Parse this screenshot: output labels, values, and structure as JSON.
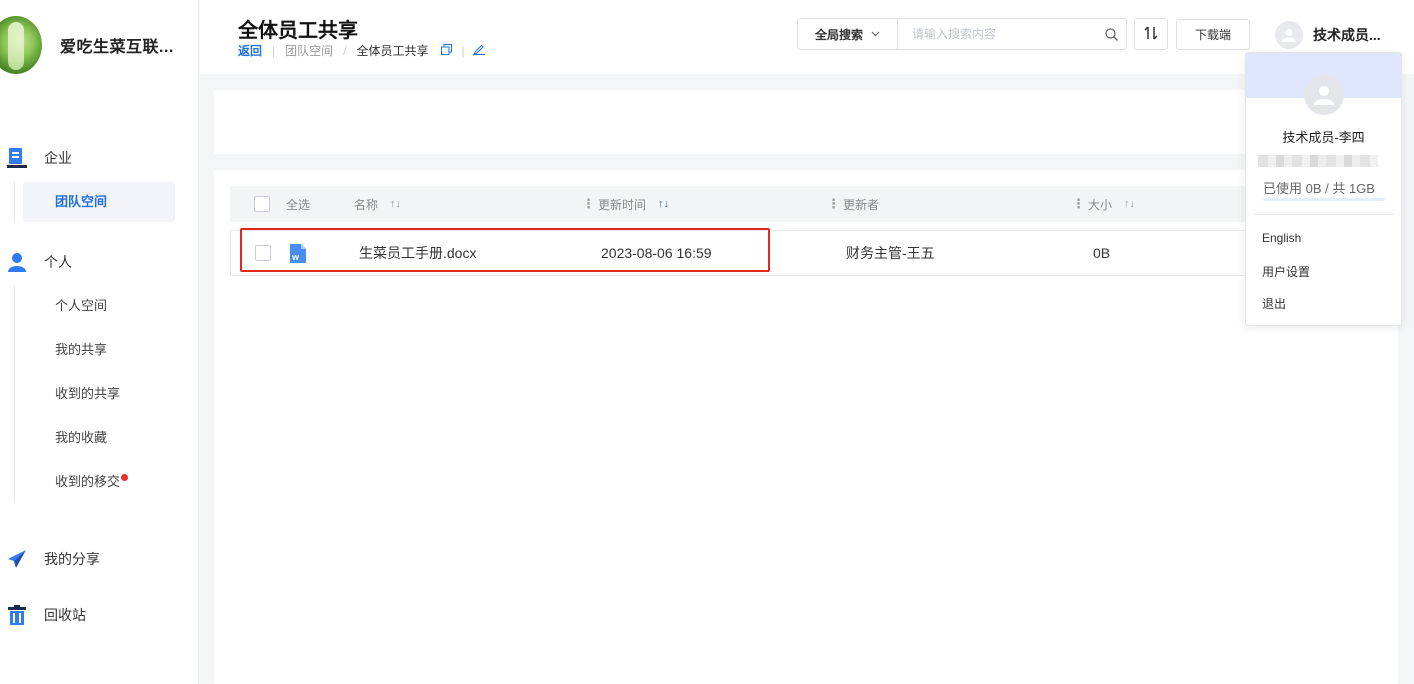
{
  "app": {
    "name": "爱吃生菜互联..."
  },
  "sidebar": {
    "enterprise": {
      "label": "企业",
      "items": [
        {
          "label": "团队空间",
          "active": true
        }
      ]
    },
    "personal": {
      "label": "个人",
      "items": [
        {
          "label": "个人空间"
        },
        {
          "label": "我的共享"
        },
        {
          "label": "收到的共享"
        },
        {
          "label": "我的收藏"
        },
        {
          "label": "收到的移交",
          "badge": "red-dot"
        }
      ]
    },
    "share": {
      "label": "我的分享"
    },
    "recycle": {
      "label": "回收站"
    }
  },
  "header": {
    "title": "全体员工共享",
    "breadcrumb": {
      "back": "返回",
      "parent": "团队空间",
      "current": "全体员工共享"
    },
    "search": {
      "scope": "全局搜索",
      "placeholder": "请输入搜索内容",
      "value": ""
    },
    "download_label": "下载端",
    "user_short": "技术成员..."
  },
  "table": {
    "select_all": "全选",
    "columns": {
      "name": "名称",
      "updated_at": "更新时间",
      "updater": "更新者",
      "size": "大小"
    },
    "rows": [
      {
        "name": "生菜员工手册.docx",
        "updated_at": "2023-08-06 16:59",
        "updater": "财务主管-王五",
        "size": "0B",
        "file_type": "word-doc-icon"
      }
    ]
  },
  "user_menu": {
    "name": "技术成员-李四",
    "usage": "已使用 0B / 共 1GB",
    "usage_fraction": 0,
    "items": [
      "English",
      "用户设置",
      "退出"
    ]
  },
  "colors": {
    "accent": "#1f6fde",
    "highlight": "#e0281f",
    "badge": "#e9322f"
  }
}
